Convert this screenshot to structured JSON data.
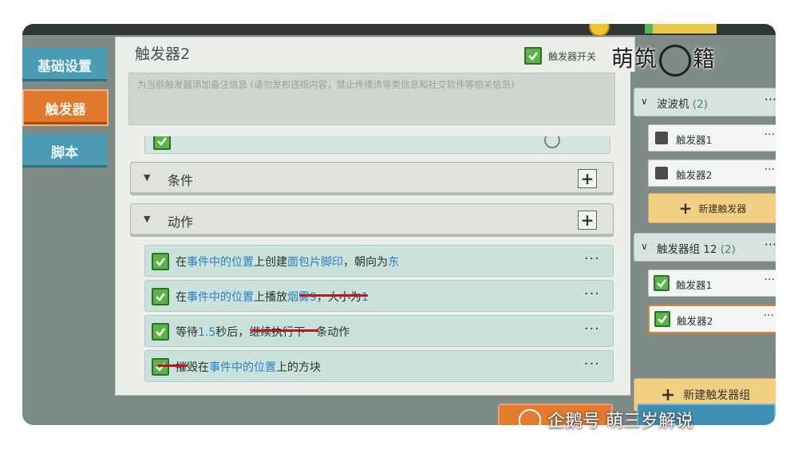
{
  "sidebar": {
    "tabs": [
      {
        "label": "基础设置"
      },
      {
        "label": "触发器"
      },
      {
        "label": "脚本"
      }
    ]
  },
  "editor": {
    "title": "触发器2",
    "switch_label": "触发器开关",
    "note_placeholder": "为当前触发器添加备注信息 (请勿发布违规内容，禁止传播诱导类信息和社交软件等相关信息)",
    "sections": {
      "conditions": "条件",
      "actions": "动作"
    },
    "actions": [
      {
        "parts": [
          {
            "t": "在",
            "hl": false
          },
          {
            "t": "事件中的位置",
            "hl": true
          },
          {
            "t": "上创建",
            "hl": false
          },
          {
            "t": "面包片脚印",
            "hl": true
          },
          {
            "t": "，朝向为",
            "hl": false
          },
          {
            "t": "东",
            "hl": true
          }
        ]
      },
      {
        "parts": [
          {
            "t": "在",
            "hl": false
          },
          {
            "t": "事件中的位置",
            "hl": true
          },
          {
            "t": "上播放",
            "hl": false
          },
          {
            "t": "烟雾9",
            "hl": true
          },
          {
            "t": "，大小为",
            "hl": false
          },
          {
            "t": "1",
            "hl": true
          }
        ]
      },
      {
        "parts": [
          {
            "t": "等待",
            "hl": false
          },
          {
            "t": "1.5",
            "hl": true
          },
          {
            "t": "秒后，继续执行下一条动作",
            "hl": false
          }
        ]
      },
      {
        "parts": [
          {
            "t": "摧毁在",
            "hl": false
          },
          {
            "t": "事件中的位置",
            "hl": true
          },
          {
            "t": "上的方块",
            "hl": false
          }
        ]
      }
    ],
    "more_glyph": "···"
  },
  "tree": {
    "groups": [
      {
        "name": "波波机",
        "count": "(2)",
        "items": [
          {
            "label": "触发器1",
            "checked": false
          },
          {
            "label": "触发器2",
            "checked": false
          }
        ],
        "new_button": "新建触发器"
      },
      {
        "name": "触发器组 12",
        "count": "(2)",
        "items": [
          {
            "label": "触发器1",
            "checked": true
          },
          {
            "label": "触发器2",
            "checked": true,
            "selected": true
          }
        ]
      }
    ],
    "new_group_button": "新建触发器组"
  },
  "overlay": {
    "logo_left": "萌筑",
    "logo_right": "籍",
    "watermark": "企鹅号 萌三岁解说"
  },
  "colors": {
    "accent_orange": "#e2782b",
    "tab_blue": "#4a9bb3",
    "check_green": "#5ab544",
    "highlight_blue": "#2b7fc4",
    "annotation_red": "#c0151b"
  }
}
